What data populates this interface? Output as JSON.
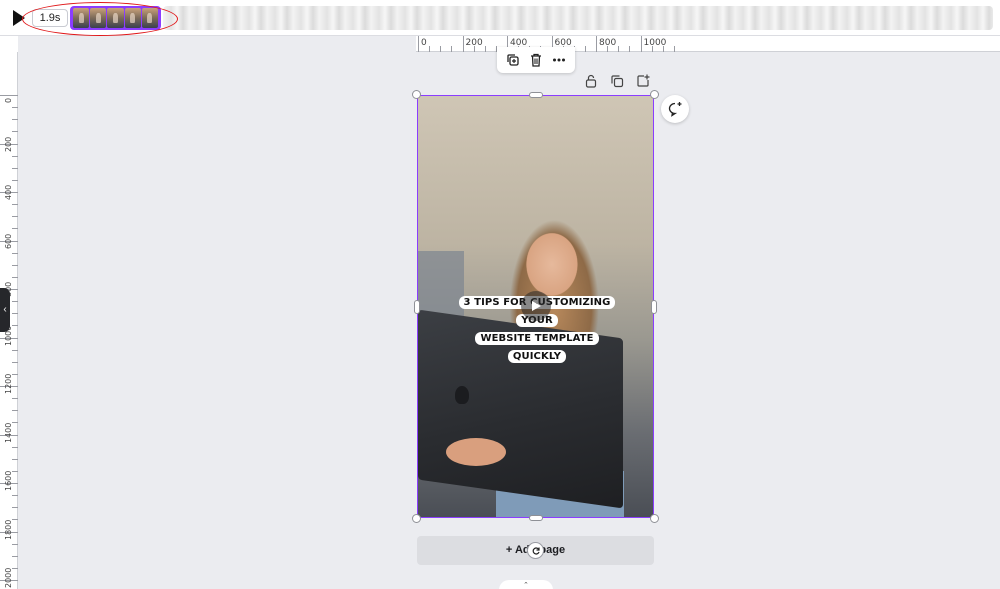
{
  "timeline": {
    "play_icon": "play-icon",
    "duration_label": "1.9s"
  },
  "ruler_top": {
    "labels": [
      "0",
      "200",
      "400",
      "600",
      "800",
      "1000"
    ]
  },
  "ruler_left": {
    "labels": [
      "0",
      "200",
      "400",
      "600",
      "800",
      "1000",
      "1200",
      "1400",
      "1600",
      "1800",
      "2000"
    ]
  },
  "context_toolbar": {
    "icons": [
      "duplicate-icon",
      "trash-icon",
      "more-icon"
    ]
  },
  "page_tools": {
    "icons": [
      "lock-icon",
      "copy-page-icon",
      "add-page-icon"
    ]
  },
  "canvas": {
    "caption_line1": "3 TIPS FOR CUSTOMIZING YOUR",
    "caption_line2": "WEBSITE TEMPLATE QUICKLY"
  },
  "comment_button": {
    "icon": "add-comment-icon"
  },
  "add_page_label": "+ Add page",
  "colors": {
    "accent": "#8b3dff",
    "annotation": "#e0181a"
  }
}
